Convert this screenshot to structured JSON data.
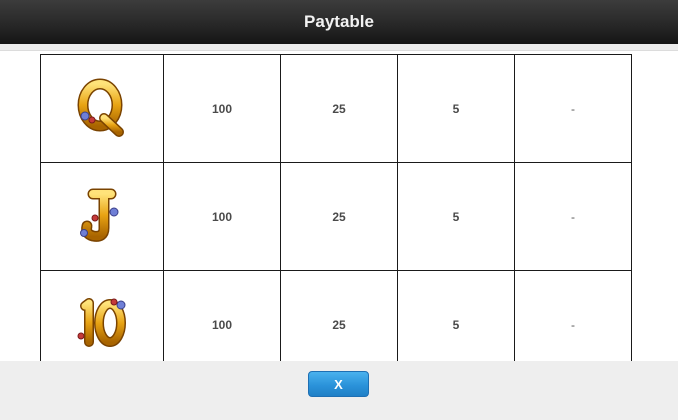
{
  "header": {
    "title": "Paytable"
  },
  "table": {
    "rows": [
      {
        "symbol": "Q",
        "icon": "q-symbol-icon",
        "values": [
          "100",
          "25",
          "5",
          "-"
        ]
      },
      {
        "symbol": "J",
        "icon": "j-symbol-icon",
        "values": [
          "100",
          "25",
          "5",
          "-"
        ]
      },
      {
        "symbol": "10",
        "icon": "ten-symbol-icon",
        "values": [
          "100",
          "25",
          "5",
          "-"
        ]
      }
    ]
  },
  "footer": {
    "close_label": "X"
  },
  "colors": {
    "header_bg": "#2a2a2a",
    "button_blue": "#2b93da",
    "symbol_gold": "#e8a313",
    "gem_blue": "#6f7fd6",
    "gem_red": "#c53a3a"
  }
}
